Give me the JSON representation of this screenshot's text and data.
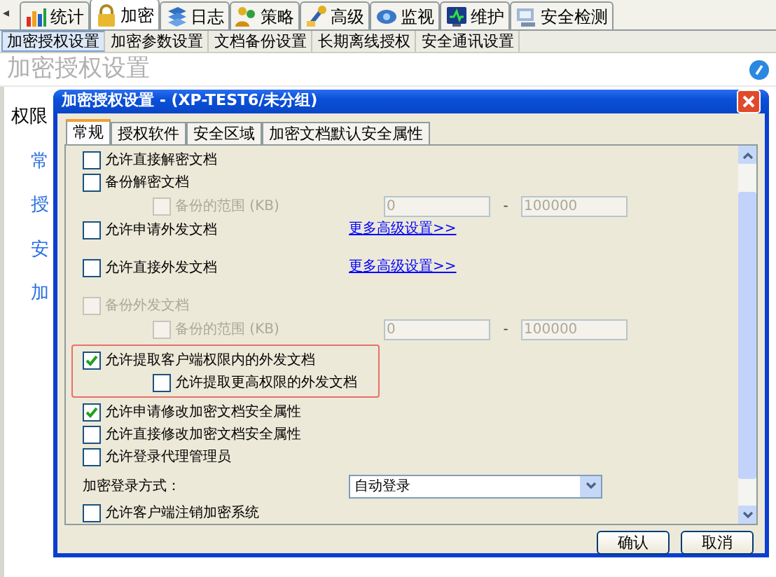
{
  "top_tabs": {
    "scroll_arrow": "◂",
    "tabs": [
      {
        "label": "统计",
        "selected": false
      },
      {
        "label": "加密",
        "selected": true
      },
      {
        "label": "日志",
        "selected": false
      },
      {
        "label": "策略",
        "selected": false
      },
      {
        "label": "高级",
        "selected": false
      },
      {
        "label": "监视",
        "selected": false
      },
      {
        "label": "维护",
        "selected": false
      },
      {
        "label": "安全检测",
        "selected": false
      }
    ]
  },
  "sub_toolbar": [
    {
      "label": "加密授权设置",
      "selected": true
    },
    {
      "label": "加密参数设置",
      "selected": false
    },
    {
      "label": "文档备份设置",
      "selected": false
    },
    {
      "label": "长期离线授权",
      "selected": false
    },
    {
      "label": "安全通讯设置",
      "selected": false
    }
  ],
  "page_title": "加密授权设置",
  "background": {
    "heading": "权限",
    "links": [
      "常",
      "授",
      "安",
      "加"
    ]
  },
  "dialog": {
    "title": "加密授权设置 - (XP-TEST6/未分组)",
    "tabs": [
      {
        "label": "常规",
        "selected": true
      },
      {
        "label": "授权软件",
        "selected": false
      },
      {
        "label": "安全区域",
        "selected": false
      },
      {
        "label": "加密文档默认安全属性",
        "selected": false
      }
    ],
    "rows": [
      {
        "kind": "checkbox",
        "label": "允许直接解密文档",
        "checked": false,
        "disabled": false
      },
      {
        "kind": "checkbox",
        "label": "备份解密文档",
        "checked": false,
        "disabled": false,
        "children": [
          {
            "kind": "range",
            "label": "备份的范围 (KB)",
            "checked": false,
            "disabled": true,
            "from": "0",
            "separator": "-",
            "to": "100000"
          }
        ]
      },
      {
        "kind": "checkbox",
        "label": "允许申请外发文档",
        "checked": false,
        "disabled": false,
        "link": "更多高级设置>>"
      },
      {
        "kind": "checkbox",
        "label": "允许直接外发文档",
        "checked": false,
        "disabled": false,
        "link": "更多高级设置>>"
      },
      {
        "kind": "checkbox",
        "label": "备份外发文档",
        "checked": false,
        "disabled": true,
        "children": [
          {
            "kind": "range",
            "label": "备份的范围 (KB)",
            "checked": false,
            "disabled": true,
            "from": "0",
            "separator": "-",
            "to": "100000"
          }
        ]
      },
      {
        "kind": "checkbox",
        "label": "允许提取客户端权限内的外发文档",
        "checked": true,
        "disabled": false,
        "highlighted": true,
        "children": [
          {
            "kind": "checkbox",
            "label": "允许提取更高权限的外发文档",
            "checked": false,
            "disabled": false
          }
        ]
      },
      {
        "kind": "checkbox",
        "label": "允许申请修改加密文档安全属性",
        "checked": true,
        "disabled": false
      },
      {
        "kind": "checkbox",
        "label": "允许直接修改加密文档安全属性",
        "checked": false,
        "disabled": false
      },
      {
        "kind": "checkbox",
        "label": "允许登录代理管理员",
        "checked": false,
        "disabled": false
      },
      {
        "kind": "select",
        "label": "加密登录方式：",
        "value": "自动登录"
      },
      {
        "kind": "checkbox",
        "label": "允许客户端注销加密系统",
        "checked": false,
        "disabled": false
      }
    ],
    "buttons": [
      "确认",
      "取消"
    ]
  }
}
